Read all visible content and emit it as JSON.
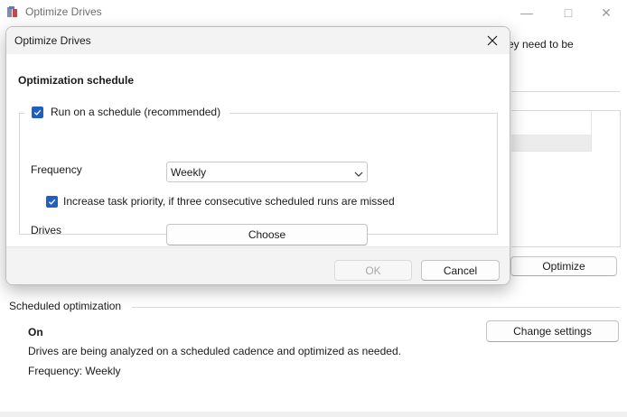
{
  "main_window": {
    "title": "Optimize Drives",
    "caption_min": "—",
    "caption_max": "□",
    "caption_close": "✕",
    "background_text_fragment": "ey need to be",
    "optimize_label": "Optimize",
    "scheduled_section_title": "Scheduled optimization",
    "schedule_status": "On",
    "schedule_description": "Drives are being analyzed on a scheduled cadence and optimized as needed.",
    "schedule_frequency": "Frequency: Weekly",
    "change_settings_label": "Change settings"
  },
  "dialog": {
    "title": "Optimize Drives",
    "heading": "Optimization schedule",
    "run_on_schedule_label": "Run on a schedule (recommended)",
    "run_on_schedule_checked": true,
    "frequency_label": "Frequency",
    "frequency_value": "Weekly",
    "increase_priority_label": "Increase task priority, if three consecutive scheduled runs are missed",
    "increase_priority_checked": true,
    "drives_label": "Drives",
    "choose_label": "Choose",
    "ok_label": "OK",
    "ok_enabled": false,
    "cancel_label": "Cancel"
  },
  "colors": {
    "accent": "#1f5fbf",
    "disabled_text": "#a8a8a8",
    "titlebar_bg": "#f3f3f3"
  },
  "icons": {
    "app": "defrag-app-icon",
    "dialog_close": "close-icon",
    "dropdown": "chevron-down-icon",
    "checkbox": "checkmark-icon"
  }
}
